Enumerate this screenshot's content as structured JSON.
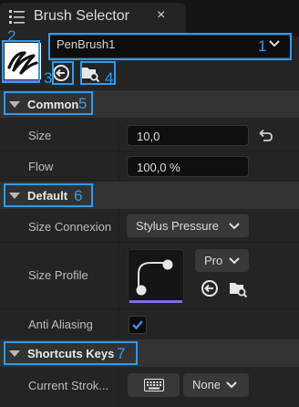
{
  "tab": {
    "title": "Brush Selector",
    "close": "×"
  },
  "preset": {
    "value": "PenBrush1"
  },
  "annotations": [
    "1",
    "2",
    "3",
    "4",
    "5",
    "6",
    "7"
  ],
  "sections": {
    "common": {
      "title": "Common",
      "rows": {
        "size": {
          "label": "Size",
          "value": "10,0"
        },
        "flow": {
          "label": "Flow",
          "value": "100,0 %"
        }
      }
    },
    "default": {
      "title": "Default",
      "rows": {
        "size_connexion": {
          "label": "Size Connexion",
          "value": "Stylus Pressure"
        },
        "size_profile": {
          "label": "Size Profile",
          "combo": "Pro"
        },
        "anti_aliasing": {
          "label": "Anti Aliasing",
          "checked": true
        }
      }
    },
    "shortcuts": {
      "title": "Shortcuts Keys",
      "rows": {
        "current_stroke": {
          "label": "Current Strok...",
          "combo": "None"
        }
      }
    }
  },
  "colors": {
    "accent": "#2a9df4",
    "underline": "#7a6fe8",
    "checkmark": "#3d8ef0"
  },
  "icons": [
    "list-icon",
    "close-icon",
    "brush-stroke-icon",
    "chevron-down-icon",
    "reset-arrow-icon",
    "browse-folder-icon",
    "caret-down-icon",
    "curve-profile-icon",
    "checkmark-icon",
    "keyboard-icon"
  ]
}
